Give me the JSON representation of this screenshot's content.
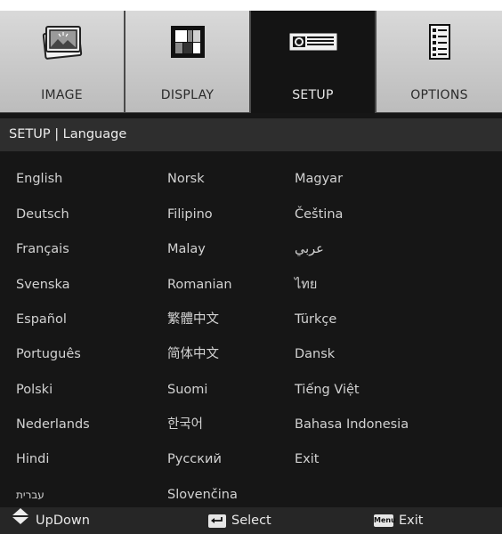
{
  "tabs": [
    {
      "label": "IMAGE",
      "icon": "image-icon",
      "active": false
    },
    {
      "label": "DISPLAY",
      "icon": "display-icon",
      "active": false
    },
    {
      "label": "SETUP",
      "icon": "setup-icon",
      "active": true
    },
    {
      "label": "OPTIONS",
      "icon": "options-icon",
      "active": false
    }
  ],
  "breadcrumb": "SETUP | Language",
  "languages": {
    "col1": [
      "English",
      "Deutsch",
      "Français",
      "Svenska",
      "Español",
      "Português",
      "Polski",
      "Nederlands",
      "Hindi",
      "עברית"
    ],
    "col2": [
      "Norsk",
      "Filipino",
      "Malay",
      "Romanian",
      "繁體中文",
      "简体中文",
      "Suomi",
      "한국어",
      "Русский",
      "Slovenčina"
    ],
    "col3": [
      "Magyar",
      "Čeština",
      "عربي",
      "ไทย",
      "Türkçe",
      "Dansk",
      "Tiếng Việt",
      "Bahasa Indonesia",
      "Exit"
    ]
  },
  "footer": {
    "updown_label": "UpDown",
    "select_label": "Select",
    "menu_key_label": "Menu",
    "exit_label": "Exit"
  },
  "colors": {
    "panel_bg": "#161616",
    "tab_bg": "#cfcfcf",
    "tab_active_bg": "#141414",
    "breadcrumb_bg": "#2e2e2e",
    "footer_bg": "#262626",
    "text": "#d2d2d2"
  }
}
